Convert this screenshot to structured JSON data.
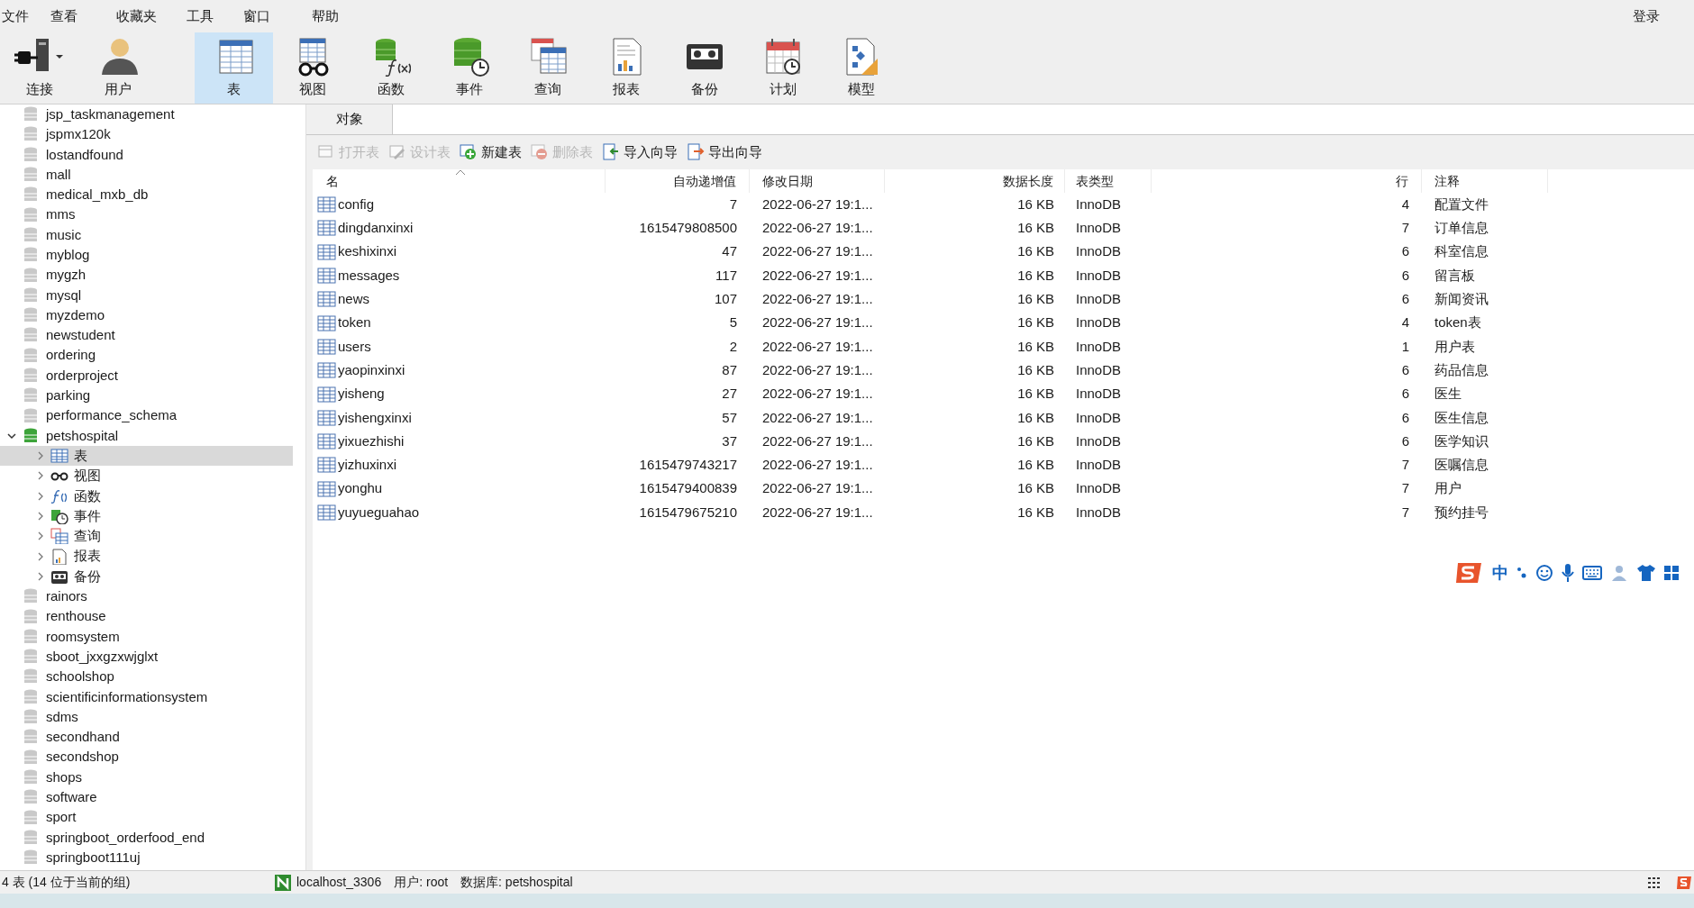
{
  "menu": [
    "文件",
    "查看",
    "收藏夹",
    "工具",
    "窗口",
    "帮助"
  ],
  "login": "登录",
  "toolbar": [
    {
      "label": "连接",
      "selected": false
    },
    {
      "label": "用户",
      "selected": false
    },
    {
      "label": "表",
      "selected": true
    },
    {
      "label": "视图",
      "selected": false
    },
    {
      "label": "函数",
      "selected": false
    },
    {
      "label": "事件",
      "selected": false
    },
    {
      "label": "查询",
      "selected": false
    },
    {
      "label": "报表",
      "selected": false
    },
    {
      "label": "备份",
      "selected": false
    },
    {
      "label": "计划",
      "selected": false
    },
    {
      "label": "模型",
      "selected": false
    }
  ],
  "sidebar": {
    "items": [
      {
        "label": "jsp_taskmanagement",
        "expanded": false
      },
      {
        "label": "jspmx120k",
        "expanded": false
      },
      {
        "label": "lostandfound",
        "expanded": false
      },
      {
        "label": "mall",
        "expanded": false
      },
      {
        "label": "medical_mxb_db",
        "expanded": false
      },
      {
        "label": "mms",
        "expanded": false
      },
      {
        "label": "music",
        "expanded": false
      },
      {
        "label": "myblog",
        "expanded": false
      },
      {
        "label": "mygzh",
        "expanded": false
      },
      {
        "label": "mysql",
        "expanded": false
      },
      {
        "label": "myzdemo",
        "expanded": false
      },
      {
        "label": "newstudent",
        "expanded": false
      },
      {
        "label": "ordering",
        "expanded": false
      },
      {
        "label": "orderproject",
        "expanded": false
      },
      {
        "label": "parking",
        "expanded": false
      },
      {
        "label": "performance_schema",
        "expanded": false
      },
      {
        "label": "petshospital",
        "expanded": true,
        "children": [
          {
            "label": "表",
            "selected": true,
            "expanded": false
          },
          {
            "label": "视图",
            "selected": false,
            "expanded": false
          },
          {
            "label": "函数",
            "selected": false,
            "expanded": false
          },
          {
            "label": "事件",
            "selected": false,
            "expanded": false
          },
          {
            "label": "查询",
            "selected": false,
            "expanded": false
          },
          {
            "label": "报表",
            "selected": false,
            "expanded": false
          },
          {
            "label": "备份",
            "selected": false,
            "expanded": false
          }
        ]
      },
      {
        "label": "rainors",
        "expanded": false
      },
      {
        "label": "renthouse",
        "expanded": false
      },
      {
        "label": "roomsystem",
        "expanded": false
      },
      {
        "label": "sboot_jxxgzxwjglxt",
        "expanded": false
      },
      {
        "label": "schoolshop",
        "expanded": false
      },
      {
        "label": "scientificinformationsystem",
        "expanded": false
      },
      {
        "label": "sdms",
        "expanded": false
      },
      {
        "label": "secondhand",
        "expanded": false
      },
      {
        "label": "secondshop",
        "expanded": false
      },
      {
        "label": "shops",
        "expanded": false
      },
      {
        "label": "software",
        "expanded": false
      },
      {
        "label": "sport",
        "expanded": false
      },
      {
        "label": "springboot_orderfood_end",
        "expanded": false
      },
      {
        "label": "springboot111uj",
        "expanded": false
      }
    ]
  },
  "tab": {
    "label": "对象",
    "selected": true
  },
  "actions": [
    {
      "label": "打开表",
      "disabled": true
    },
    {
      "label": "设计表",
      "disabled": true
    },
    {
      "label": "新建表",
      "disabled": false
    },
    {
      "label": "删除表",
      "disabled": true
    },
    {
      "label": "导入向导",
      "disabled": false
    },
    {
      "label": "导出向导",
      "disabled": false
    }
  ],
  "table": {
    "columns": [
      "名",
      "自动递增值",
      "修改日期",
      "数据长度",
      "表类型",
      "行",
      "注释"
    ],
    "rows": [
      [
        "config",
        "7",
        "2022-06-27 19:1...",
        "16 KB",
        "InnoDB",
        "4",
        "配置文件"
      ],
      [
        "dingdanxinxi",
        "1615479808500",
        "2022-06-27 19:1...",
        "16 KB",
        "InnoDB",
        "7",
        "订单信息"
      ],
      [
        "keshixinxi",
        "47",
        "2022-06-27 19:1...",
        "16 KB",
        "InnoDB",
        "6",
        "科室信息"
      ],
      [
        "messages",
        "117",
        "2022-06-27 19:1...",
        "16 KB",
        "InnoDB",
        "6",
        "留言板"
      ],
      [
        "news",
        "107",
        "2022-06-27 19:1...",
        "16 KB",
        "InnoDB",
        "6",
        "新闻资讯"
      ],
      [
        "token",
        "5",
        "2022-06-27 19:1...",
        "16 KB",
        "InnoDB",
        "4",
        "token表"
      ],
      [
        "users",
        "2",
        "2022-06-27 19:1...",
        "16 KB",
        "InnoDB",
        "1",
        "用户表"
      ],
      [
        "yaopinxinxi",
        "87",
        "2022-06-27 19:1...",
        "16 KB",
        "InnoDB",
        "6",
        "药品信息"
      ],
      [
        "yisheng",
        "27",
        "2022-06-27 19:1...",
        "16 KB",
        "InnoDB",
        "6",
        "医生"
      ],
      [
        "yishengxinxi",
        "57",
        "2022-06-27 19:1...",
        "16 KB",
        "InnoDB",
        "6",
        "医生信息"
      ],
      [
        "yixuezhishi",
        "37",
        "2022-06-27 19:1...",
        "16 KB",
        "InnoDB",
        "6",
        "医学知识"
      ],
      [
        "yizhuxinxi",
        "1615479743217",
        "2022-06-27 19:1...",
        "16 KB",
        "InnoDB",
        "7",
        "医嘱信息"
      ],
      [
        "yonghu",
        "1615479400839",
        "2022-06-27 19:1...",
        "16 KB",
        "InnoDB",
        "7",
        "用户"
      ],
      [
        "yuyueguahao",
        "1615479675210",
        "2022-06-27 19:1...",
        "16 KB",
        "InnoDB",
        "7",
        "预约挂号"
      ]
    ]
  },
  "ime": {
    "label": "中"
  },
  "status_bar": {
    "count": "4 表 (14 位于当前的组)",
    "connection": "localhost_3306",
    "user": "用户: root",
    "database": "数据库: petshospital"
  }
}
